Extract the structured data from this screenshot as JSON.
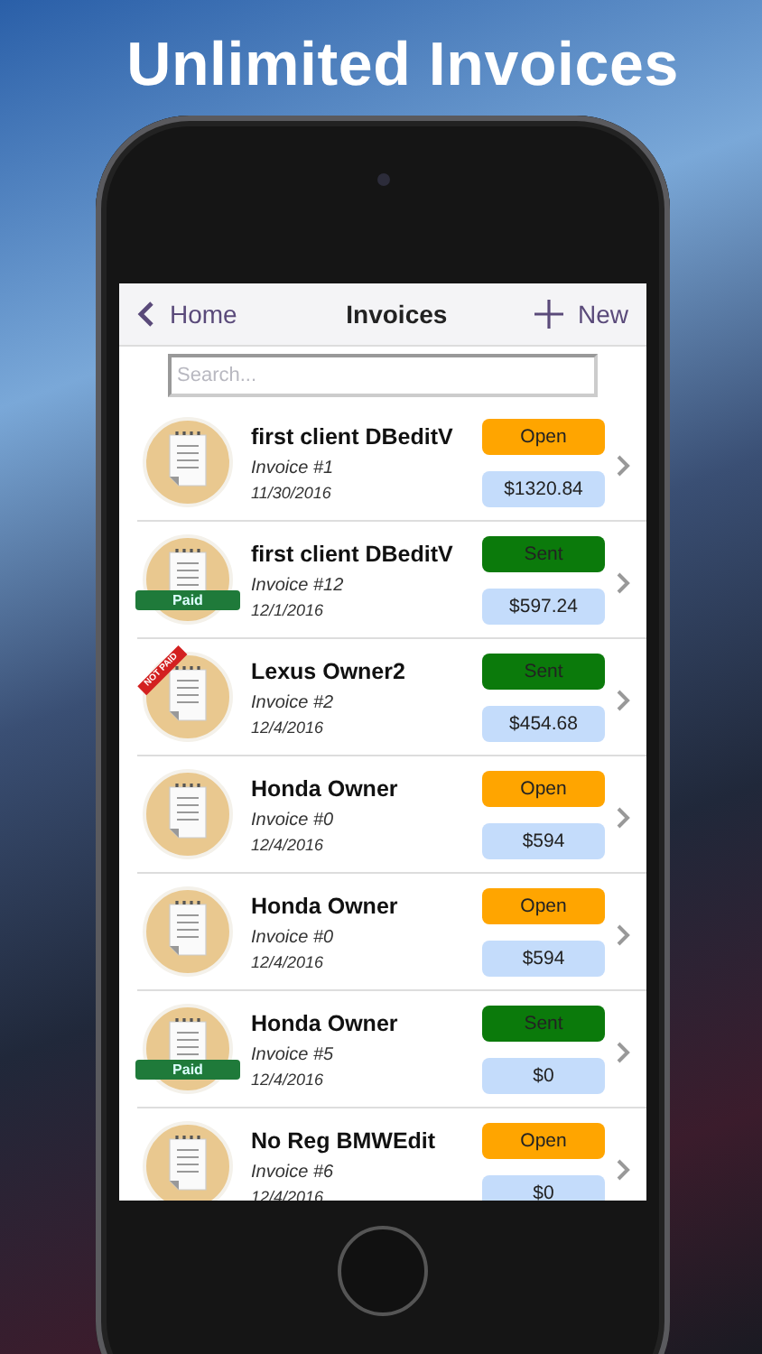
{
  "headline": "Unlimited Invoices",
  "nav": {
    "back": "Home",
    "title": "Invoices",
    "new": "New"
  },
  "search": {
    "placeholder": "Search..."
  },
  "invoices": [
    {
      "client": "first client DBeditV",
      "number": "Invoice #1",
      "date": "11/30/2016",
      "status": {
        "kind": "open",
        "label": "Open"
      },
      "amount": "$1320.84"
    },
    {
      "client": "first client DBeditV",
      "number": "Invoice #12",
      "date": "12/1/2016",
      "status": {
        "kind": "sent",
        "label": "Sent"
      },
      "amount": "$597.24",
      "ribbon": {
        "kind": "paid",
        "text": "Paid"
      }
    },
    {
      "client": "Lexus Owner2",
      "number": "Invoice #2",
      "date": "12/4/2016",
      "status": {
        "kind": "sent",
        "label": "Sent"
      },
      "amount": "$454.68",
      "ribbon": {
        "kind": "not_paid",
        "text": "NOT PAID"
      }
    },
    {
      "client": "Honda Owner",
      "number": "Invoice #0",
      "date": "12/4/2016",
      "status": {
        "kind": "open",
        "label": "Open"
      },
      "amount": "$594"
    },
    {
      "client": "Honda Owner",
      "number": "Invoice #0",
      "date": "12/4/2016",
      "status": {
        "kind": "open",
        "label": "Open"
      },
      "amount": "$594"
    },
    {
      "client": "Honda Owner",
      "number": "Invoice #5",
      "date": "12/4/2016",
      "status": {
        "kind": "sent",
        "label": "Sent"
      },
      "amount": "$0",
      "ribbon": {
        "kind": "paid",
        "text": "Paid"
      }
    },
    {
      "client": "No Reg BMWEdit",
      "number": "Invoice #6",
      "date": "12/4/2016",
      "status": {
        "kind": "open",
        "label": "Open"
      },
      "amount": "$0"
    }
  ]
}
